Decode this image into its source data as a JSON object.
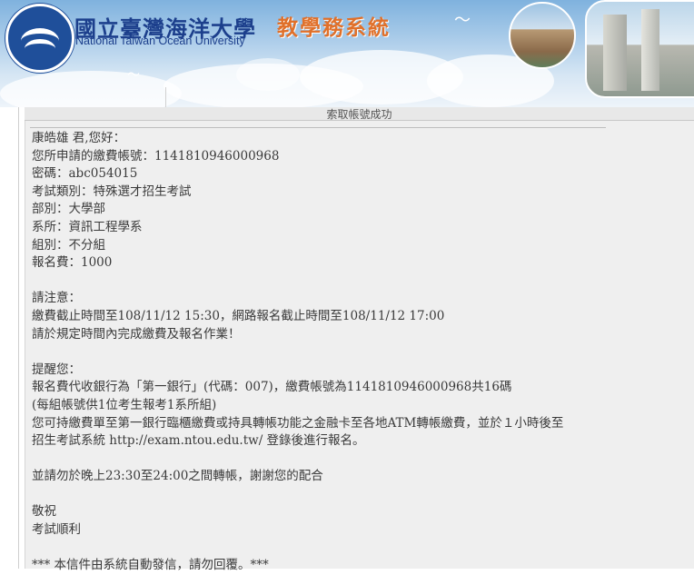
{
  "header": {
    "school_name_zh": "國立臺灣海洋大學",
    "school_name_en": "National Taiwan Ocean University",
    "system_name": "教學務系統",
    "logo_icon": "ntou-logo-icon"
  },
  "page": {
    "title": "索取帳號成功"
  },
  "letter": {
    "greeting": "康皓雄  君,您好：",
    "account": "您所申請的繳費帳號：1141810946000968",
    "password": "密碼：abc054015",
    "exam_type": "考試類別：特殊選才招生考試",
    "division": "部別：大學部",
    "department": "系所：資訊工程學系",
    "group": "組別：不分組",
    "fee": "報名費：1000",
    "notice_heading": "請注意：",
    "notice_deadline": "繳費截止時間至108/11/12  15:30，網路報名截止時間至108/11/12  17:00",
    "notice_complete": "請於規定時間內完成繳費及報名作業！",
    "reminder_heading": "提醒您：",
    "reminder_bank": "報名費代收銀行為「第一銀行」(代碼：007)，繳費帳號為1141810946000968共16碼",
    "reminder_per_group": "(每組帳號供1位考生報考1系所組)",
    "reminder_payment": "您可持繳費單至第一銀行臨櫃繳費或持具轉帳功能之金融卡至各地ATM轉帳繳費，並於１小時後至",
    "reminder_login": "招生考試系統  http://exam.ntou.edu.tw/  登錄後進行報名。",
    "transfer_warning": "並請勿於晚上23:30至24:00之間轉帳，謝謝您的配合",
    "closing_1": "敬祝",
    "closing_2": "考試順利",
    "auto_notice": "***  本信件由系統自動發信，請勿回覆。***"
  }
}
